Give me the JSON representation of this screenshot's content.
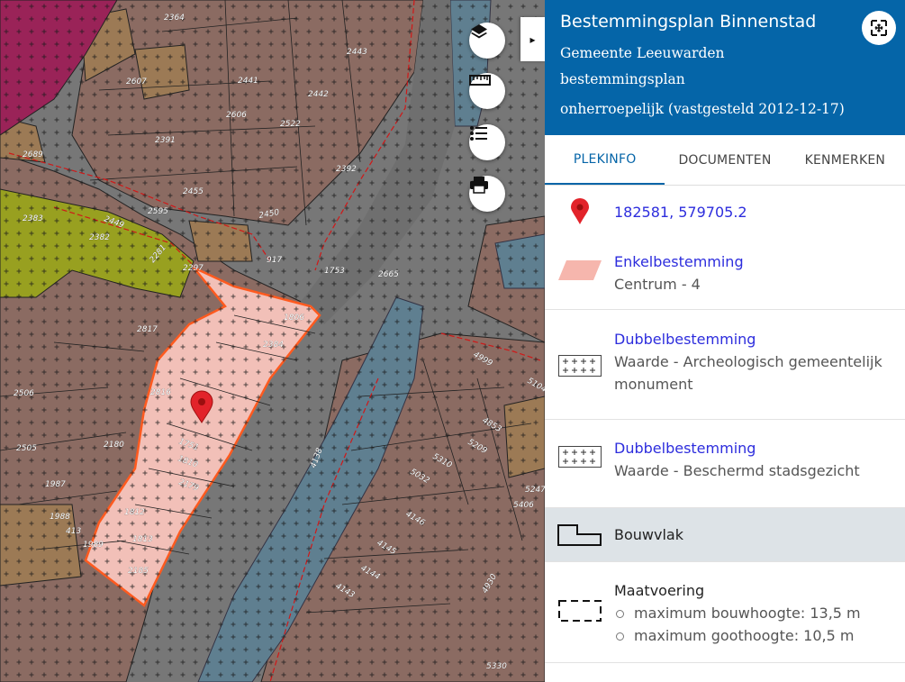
{
  "colors": {
    "header_bg": "#0565a8",
    "link_blue": "#2d2ddd",
    "marker_red": "#e2232a",
    "enkel_fill": "#f6b6ad",
    "plan_outline": "#ff5a1f"
  },
  "map": {
    "plot_labels": [
      "2364",
      "2443",
      "2607",
      "2441",
      "2442",
      "2606",
      "2522",
      "2391",
      "2689",
      "2392",
      "2455",
      "2595",
      "2450",
      "2383",
      "2449",
      "2382",
      "917",
      "1753",
      "2665",
      "2297",
      "2281",
      "2817",
      "1806",
      "2384",
      "2506",
      "2816",
      "4999",
      "5104",
      "4853",
      "2180",
      "1751",
      "5209",
      "2505",
      "1810",
      "5310",
      "5032",
      "2179",
      "4138",
      "1987",
      "1988",
      "1812",
      "4146",
      "413",
      "1989",
      "1813",
      "4145",
      "2185",
      "4144",
      "4143",
      "4930",
      "5247",
      "5406",
      "5330"
    ],
    "buttons": {
      "layers": "layers-icon",
      "measure": "ruler-icon",
      "legend": "list-icon",
      "print": "printer-icon"
    },
    "collapse_glyph": "▸"
  },
  "panel": {
    "title": "Bestemmingsplan Binnenstad",
    "municipality": "Gemeente Leeuwarden",
    "plan_type": "bestemmingsplan",
    "status": "onherroepelijk (vastgesteld 2012-12-17)",
    "tabs": [
      {
        "label": "PLEKINFO",
        "active": true
      },
      {
        "label": "DOCUMENTEN",
        "active": false
      },
      {
        "label": "KENMERKEN",
        "active": false
      }
    ],
    "coordinates": "182581, 579705.2",
    "items": [
      {
        "title": "Enkelbestemming",
        "value": "Centrum - 4",
        "icon": "enkelbestemming-swatch-icon"
      },
      {
        "title": "Dubbelbestemming",
        "value": "Waarde - Archeologisch gemeentelijk monument",
        "icon": "dubbelbestemming-swatch-icon"
      },
      {
        "title": "Dubbelbestemming",
        "value": "Waarde - Beschermd stadsgezicht",
        "icon": "dubbelbestemming-swatch-icon"
      },
      {
        "title": "Bouwvlak",
        "icon": "bouwvlak-icon"
      },
      {
        "title": "Maatvoering",
        "icon": "maatvoering-icon",
        "lines": [
          "maximum bouwhoogte: 13,5 m",
          "maximum goothoogte: 10,5 m"
        ]
      }
    ]
  }
}
